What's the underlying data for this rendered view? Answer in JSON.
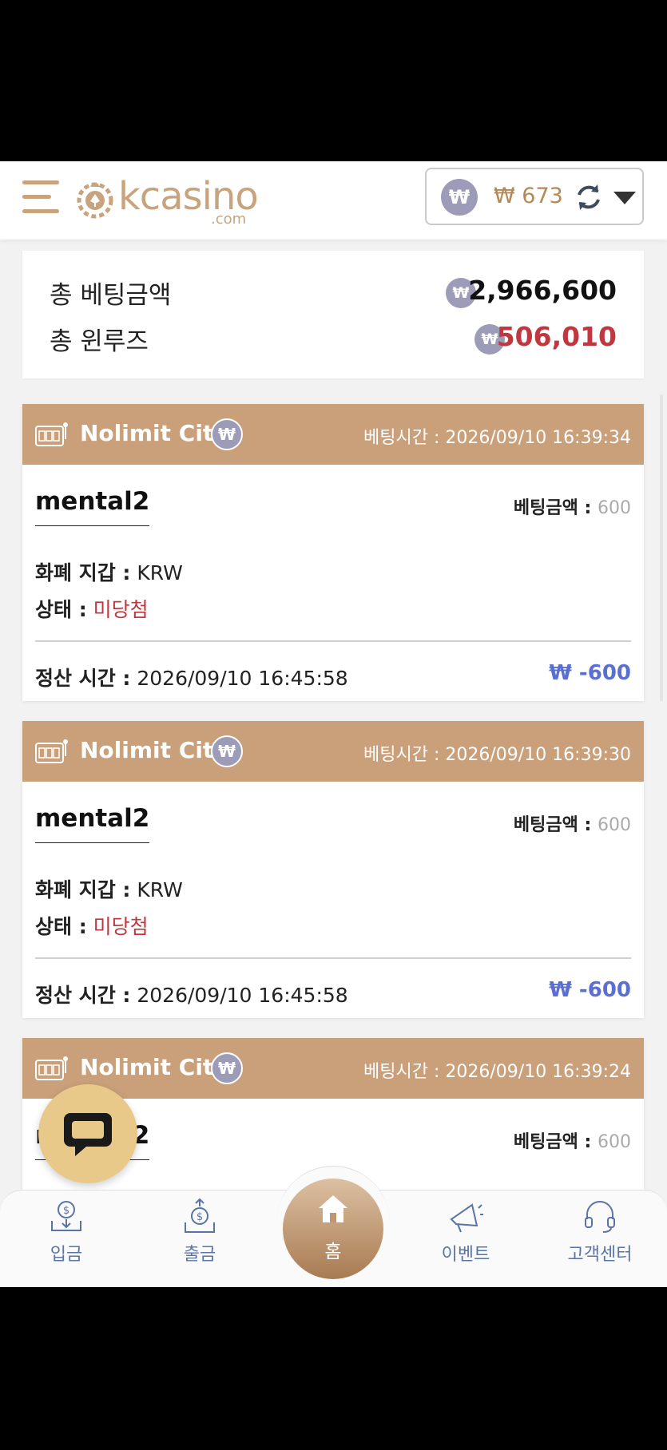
{
  "header": {
    "logo_main": "kcasino",
    "logo_sub": ".com",
    "currency_symbol": "₩",
    "balance": "₩ 673"
  },
  "summary": {
    "total_bet_label": "총 베팅금액",
    "total_bet_value": "2,966,600",
    "total_winloss_label": "총 윈루즈",
    "total_winloss_value": "506,010"
  },
  "cards": [
    {
      "provider": "Nolimit City",
      "bet_time": "베팅시간 : 2026/09/10 16:39:34",
      "game": "mental2",
      "bet_amount_label": "베팅금액 :",
      "bet_amount_value": "600",
      "wallet_label": "화폐 지갑 :",
      "wallet_value": "KRW",
      "status_label": "상태 :",
      "status_value": "미당첨",
      "settle_label": "정산 시간 :",
      "settle_value": "2026/09/10 16:45:58",
      "payout": "₩ -600"
    },
    {
      "provider": "Nolimit City",
      "bet_time": "베팅시간 : 2026/09/10 16:39:30",
      "game": "mental2",
      "bet_amount_label": "베팅금액 :",
      "bet_amount_value": "600",
      "wallet_label": "화폐 지갑 :",
      "wallet_value": "KRW",
      "status_label": "상태 :",
      "status_value": "미당첨",
      "settle_label": "정산 시간 :",
      "settle_value": "2026/09/10 16:45:58",
      "payout": "₩ -600"
    },
    {
      "provider": "Nolimit City",
      "bet_time": "베팅시간 : 2026/09/10 16:39:24",
      "game": "mental2",
      "bet_amount_label": "베팅금액 :",
      "bet_amount_value": "600"
    }
  ],
  "nav": {
    "deposit": "입금",
    "withdraw": "출금",
    "home": "홈",
    "event": "이벤트",
    "support": "고객센터"
  },
  "colors": {
    "brand": "#c7a37e",
    "card_header": "#c9a07a",
    "loss": "#c0373f",
    "payout": "#5a6fd0",
    "coin": "#9c9cb8"
  },
  "icons": {
    "menu": "hamburger-menu-icon",
    "refresh": "refresh-icon",
    "dropdown": "caret-down-icon",
    "chat": "chat-bubble-icon",
    "home": "home-icon",
    "slot": "slot-machine-icon"
  }
}
